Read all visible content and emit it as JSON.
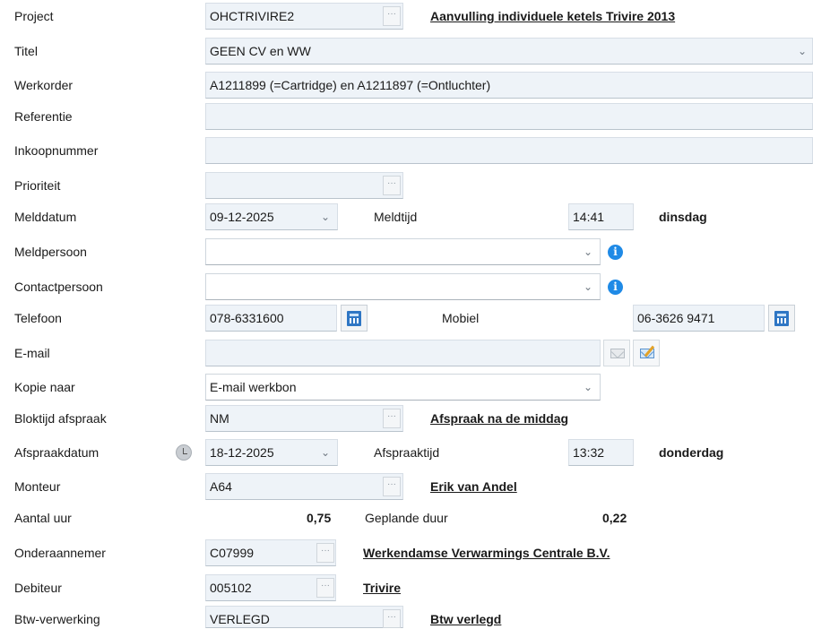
{
  "form": {
    "project": {
      "label": "Project",
      "value": "OHCTRIVIRE2",
      "link": "Aanvulling individuele ketels Trivire 2013"
    },
    "titel": {
      "label": "Titel",
      "value": "GEEN CV en WW"
    },
    "werkorder": {
      "label": "Werkorder",
      "value": "A1211899 (=Cartridge) en A1211897 (=Ontluchter)"
    },
    "referentie": {
      "label": "Referentie",
      "value": ""
    },
    "inkoopnummer": {
      "label": "Inkoopnummer",
      "value": ""
    },
    "prioriteit": {
      "label": "Prioriteit",
      "value": ""
    },
    "melddatum": {
      "label": "Melddatum",
      "value": "09-12-2025",
      "time_label": "Meldtijd",
      "time_value": "14:41",
      "weekday": "dinsdag"
    },
    "meldpersoon": {
      "label": "Meldpersoon",
      "value": ""
    },
    "contactpersoon": {
      "label": "Contactpersoon",
      "value": ""
    },
    "telefoon": {
      "label": "Telefoon",
      "value": "078-6331600",
      "mobile_label": "Mobiel",
      "mobile_value": "06-3626 9471"
    },
    "email": {
      "label": "E-mail",
      "value": ""
    },
    "kopie": {
      "label": "Kopie naar",
      "value": "E-mail werkbon"
    },
    "bloktijd": {
      "label": "Bloktijd afspraak",
      "value": "NM",
      "link": "Afspraak na de middag"
    },
    "afspraakdatum": {
      "label": "Afspraakdatum",
      "value": "18-12-2025",
      "time_label": "Afspraaktijd",
      "time_value": "13:32",
      "weekday": "donderdag"
    },
    "monteur": {
      "label": "Monteur",
      "value": "A64",
      "link": "Erik van Andel"
    },
    "aantal_uur": {
      "label": "Aantal uur",
      "value": "0,75",
      "planned_label": "Geplande duur",
      "planned_value": "0,22"
    },
    "onderaannemer": {
      "label": "Onderaannemer",
      "value": "C07999",
      "link": "Werkendamse Verwarmings Centrale B.V."
    },
    "debiteur": {
      "label": "Debiteur",
      "value": "005102",
      "link": "Trivire"
    },
    "btw": {
      "label": "Btw-verwerking",
      "value": "VERLEGD",
      "link": "Btw verlegd"
    }
  },
  "icons": {
    "ellipsis": "···",
    "chevron": "⌄",
    "info": "i"
  },
  "colors": {
    "field_bg": "#eef3f8",
    "info_blue": "#1f8ae6"
  }
}
